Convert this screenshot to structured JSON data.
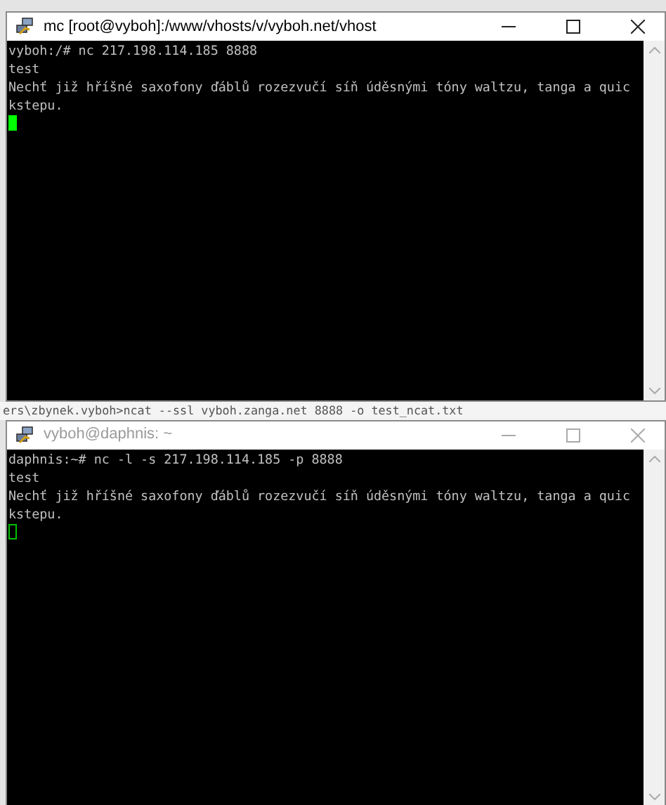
{
  "windows": [
    {
      "title": "mc [root@vyboh]:/www/vhosts/v/vyboh.net/vhost",
      "active": true,
      "lines": [
        "vyboh:/# nc 217.198.114.185 8888",
        "test",
        "Nechť již hříšné saxofony ďáblů rozezvučí síň úděsnými tóny waltzu, tanga a quic",
        "kstepu."
      ]
    },
    {
      "title": "vyboh@daphnis: ~",
      "active": false,
      "lines": [
        "daphnis:~# nc -l -s 217.198.114.185 -p 8888",
        "test",
        "Nechť již hříšné saxofony ďáblů rozezvučí síň úděsnými tóny waltzu, tanga a quic",
        "kstepu."
      ]
    }
  ],
  "background_console": {
    "line": "ers\\zbynek.vyboh>ncat --ssl vyboh.zanga.net 8888 -o test_ncat.txt"
  }
}
